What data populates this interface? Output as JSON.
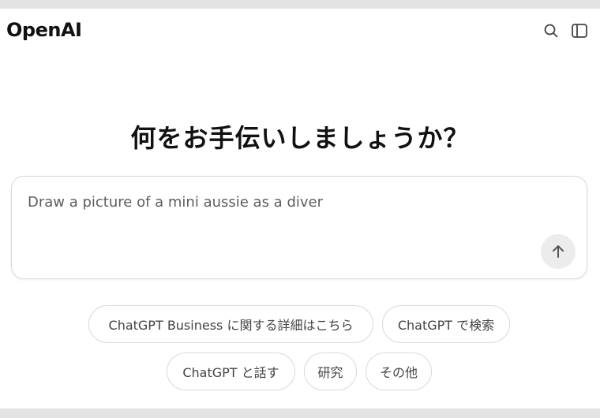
{
  "header": {
    "logo_text": "OpenAI",
    "search_icon": "search-icon",
    "sidebar_icon": "sidebar-toggle-icon"
  },
  "main": {
    "heading": "何をお手伝いしましょうか？",
    "composer": {
      "value": "Draw a picture of a mini aussie as a diver",
      "send_icon": "arrow-up-icon"
    },
    "suggestions": [
      {
        "label": "ChatGPT Business に関する詳細はこちら"
      },
      {
        "label": "ChatGPT で検索"
      },
      {
        "label": "ChatGPT と話す"
      },
      {
        "label": "研究"
      },
      {
        "label": "その他"
      }
    ]
  },
  "colors": {
    "text_primary": "#111111",
    "text_secondary": "#5d5d5d",
    "border": "#d9d9d9",
    "send_button_bg": "#ececec",
    "page_bg": "#ffffff"
  }
}
